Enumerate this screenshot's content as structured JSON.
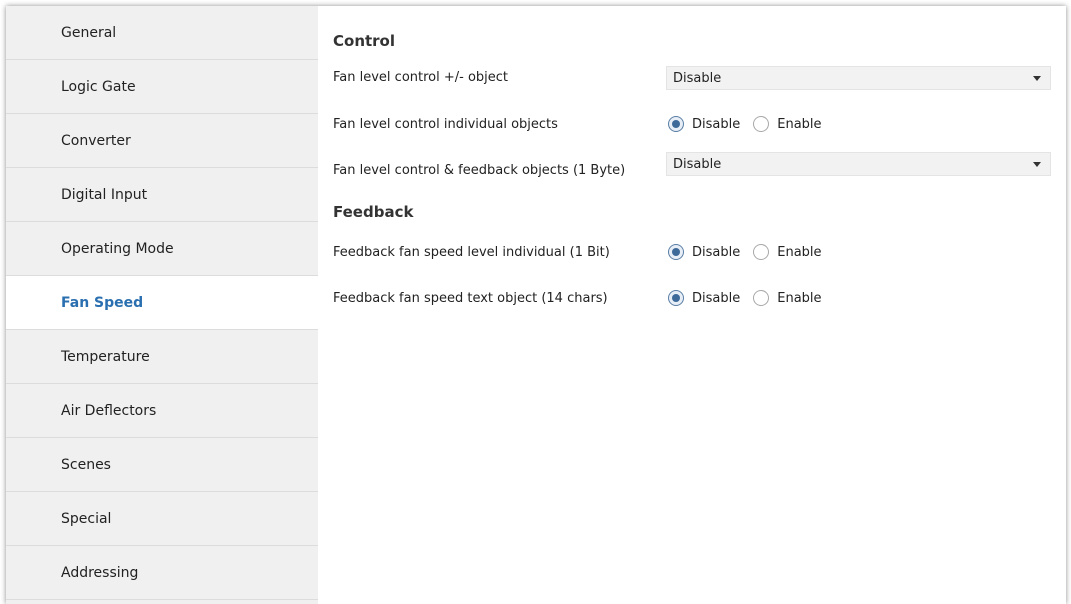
{
  "sidebar": {
    "items": [
      {
        "label": "General"
      },
      {
        "label": "Logic Gate"
      },
      {
        "label": "Converter"
      },
      {
        "label": "Digital Input"
      },
      {
        "label": "Operating Mode"
      },
      {
        "label": "Fan Speed",
        "active": true
      },
      {
        "label": "Temperature"
      },
      {
        "label": "Air Deflectors"
      },
      {
        "label": "Scenes"
      },
      {
        "label": "Special"
      },
      {
        "label": "Addressing"
      }
    ]
  },
  "main": {
    "control": {
      "title": "Control",
      "fan_level_pm": {
        "label": "Fan level control +/- object",
        "value": "Disable"
      },
      "fan_level_individual": {
        "label": "Fan level control individual objects",
        "option_disable": "Disable",
        "option_enable": "Enable",
        "selected": "Disable"
      },
      "fan_level_feedback": {
        "label": "Fan level control & feedback objects (1 Byte)",
        "value": "Disable"
      }
    },
    "feedback": {
      "title": "Feedback",
      "speed_individual": {
        "label": "Feedback fan speed level individual (1 Bit)",
        "option_disable": "Disable",
        "option_enable": "Enable",
        "selected": "Disable"
      },
      "speed_text": {
        "label": "Feedback fan speed text object (14 chars)",
        "option_disable": "Disable",
        "option_enable": "Enable",
        "selected": "Disable"
      }
    }
  },
  "colors": {
    "accent": "#2a6fb0",
    "sidebar_bg": "#f0f0f0",
    "select_bg": "#f2f2f2"
  },
  "icons": {
    "dropdown": "chevron-down-icon",
    "radio": "radio-button"
  }
}
